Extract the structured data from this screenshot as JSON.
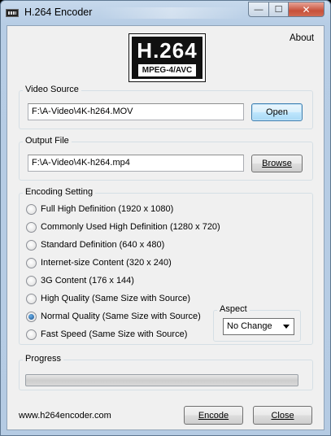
{
  "window": {
    "title": "H.264 Encoder",
    "controls": {
      "minimize": "—",
      "maximize": "☐",
      "close": "✕"
    }
  },
  "logo": {
    "main": "H.264",
    "sub": "MPEG-4/AVC"
  },
  "about_label": "About",
  "video_source": {
    "group_label": "Video Source",
    "path": "F:\\A-Video\\4K-h264.MOV",
    "button_label": "Open"
  },
  "output_file": {
    "group_label": "Output File",
    "path": "F:\\A-Video\\4K-h264.mp4",
    "button_label": "Browse"
  },
  "encoding": {
    "group_label": "Encoding Setting",
    "options": [
      {
        "label": "Full High Definition (1920 x 1080)",
        "checked": false
      },
      {
        "label": "Commonly Used High Definition (1280 x 720)",
        "checked": false
      },
      {
        "label": "Standard Definition (640 x 480)",
        "checked": false
      },
      {
        "label": "Internet-size Content (320 x 240)",
        "checked": false
      },
      {
        "label": "3G Content (176 x 144)",
        "checked": false
      },
      {
        "label": "High Quality (Same Size with Source)",
        "checked": false
      },
      {
        "label": "Normal Quality (Same Size with Source)",
        "checked": true
      },
      {
        "label": "Fast Speed (Same Size with Source)",
        "checked": false
      }
    ],
    "aspect": {
      "group_label": "Aspect",
      "selected": "No Change"
    }
  },
  "progress": {
    "group_label": "Progress",
    "value": 0
  },
  "footer": {
    "url": "www.h264encoder.com",
    "encode_label": "Encode",
    "close_label": "Close"
  }
}
